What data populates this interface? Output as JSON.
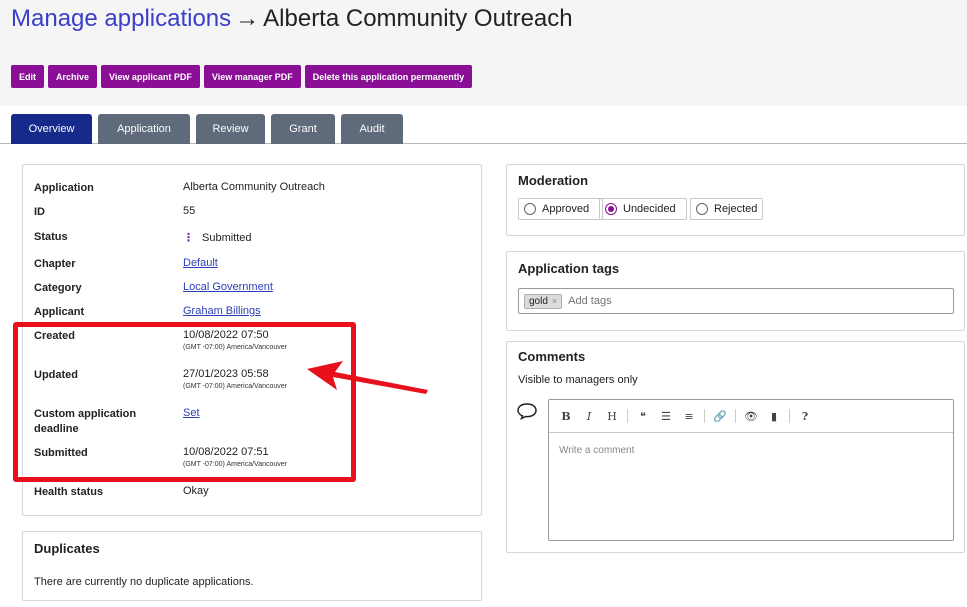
{
  "header": {
    "breadcrumb_link": "Manage applications",
    "arrow": "→",
    "current": "Alberta Community Outreach"
  },
  "actions": [
    {
      "label": "Edit"
    },
    {
      "label": "Archive"
    },
    {
      "label": "View applicant PDF"
    },
    {
      "label": "View manager PDF"
    },
    {
      "label": "Delete this application permanently"
    }
  ],
  "tabs": [
    {
      "label": "Overview",
      "active": true
    },
    {
      "label": "Application",
      "active": false
    },
    {
      "label": "Review",
      "active": false
    },
    {
      "label": "Grant",
      "active": false
    },
    {
      "label": "Audit",
      "active": false
    }
  ],
  "details": {
    "application": {
      "label": "Application",
      "value": "Alberta Community Outreach"
    },
    "id": {
      "label": "ID",
      "value": "55"
    },
    "status": {
      "label": "Status",
      "icon": "⋮",
      "value": "Submitted"
    },
    "chapter": {
      "label": "Chapter",
      "value": "Default"
    },
    "category": {
      "label": "Category",
      "value": "Local Government"
    },
    "applicant": {
      "label": "Applicant",
      "value": "Graham Billings"
    },
    "created": {
      "label": "Created",
      "value": "10/08/2022 07:50",
      "tz": "(GMT -07:00) America/Vancouver"
    },
    "updated": {
      "label": "Updated",
      "value": "27/01/2023 05:58",
      "tz": "(GMT -07:00) America/Vancouver"
    },
    "custom_deadline": {
      "label": "Custom application deadline",
      "value": "Set"
    },
    "submitted": {
      "label": "Submitted",
      "value": "10/08/2022 07:51",
      "tz": "(GMT -07:00) America/Vancouver"
    },
    "health": {
      "label": "Health status",
      "value": "Okay"
    }
  },
  "duplicates": {
    "title": "Duplicates",
    "text": "There are currently no duplicate applications."
  },
  "moderation": {
    "title": "Moderation",
    "options": [
      {
        "label": "Approved",
        "selected": false
      },
      {
        "label": "Undecided",
        "selected": true
      },
      {
        "label": "Rejected",
        "selected": false
      }
    ]
  },
  "tags": {
    "title": "Application tags",
    "items": [
      {
        "label": "gold",
        "remove": "×"
      }
    ],
    "placeholder": "Add tags"
  },
  "comments": {
    "title": "Comments",
    "subtitle": "Visible to managers only",
    "placeholder": "Write a comment",
    "toolbar": [
      "B",
      "I",
      "H",
      "❝",
      "☰",
      "≡",
      "🔗",
      "👁",
      "▮",
      "?"
    ]
  },
  "colors": {
    "accent": "#8a0f96",
    "active_tab": "#152a8a",
    "tab": "#5f6a7a",
    "annotation": "#e8101a",
    "link": "#3a3ec8"
  }
}
